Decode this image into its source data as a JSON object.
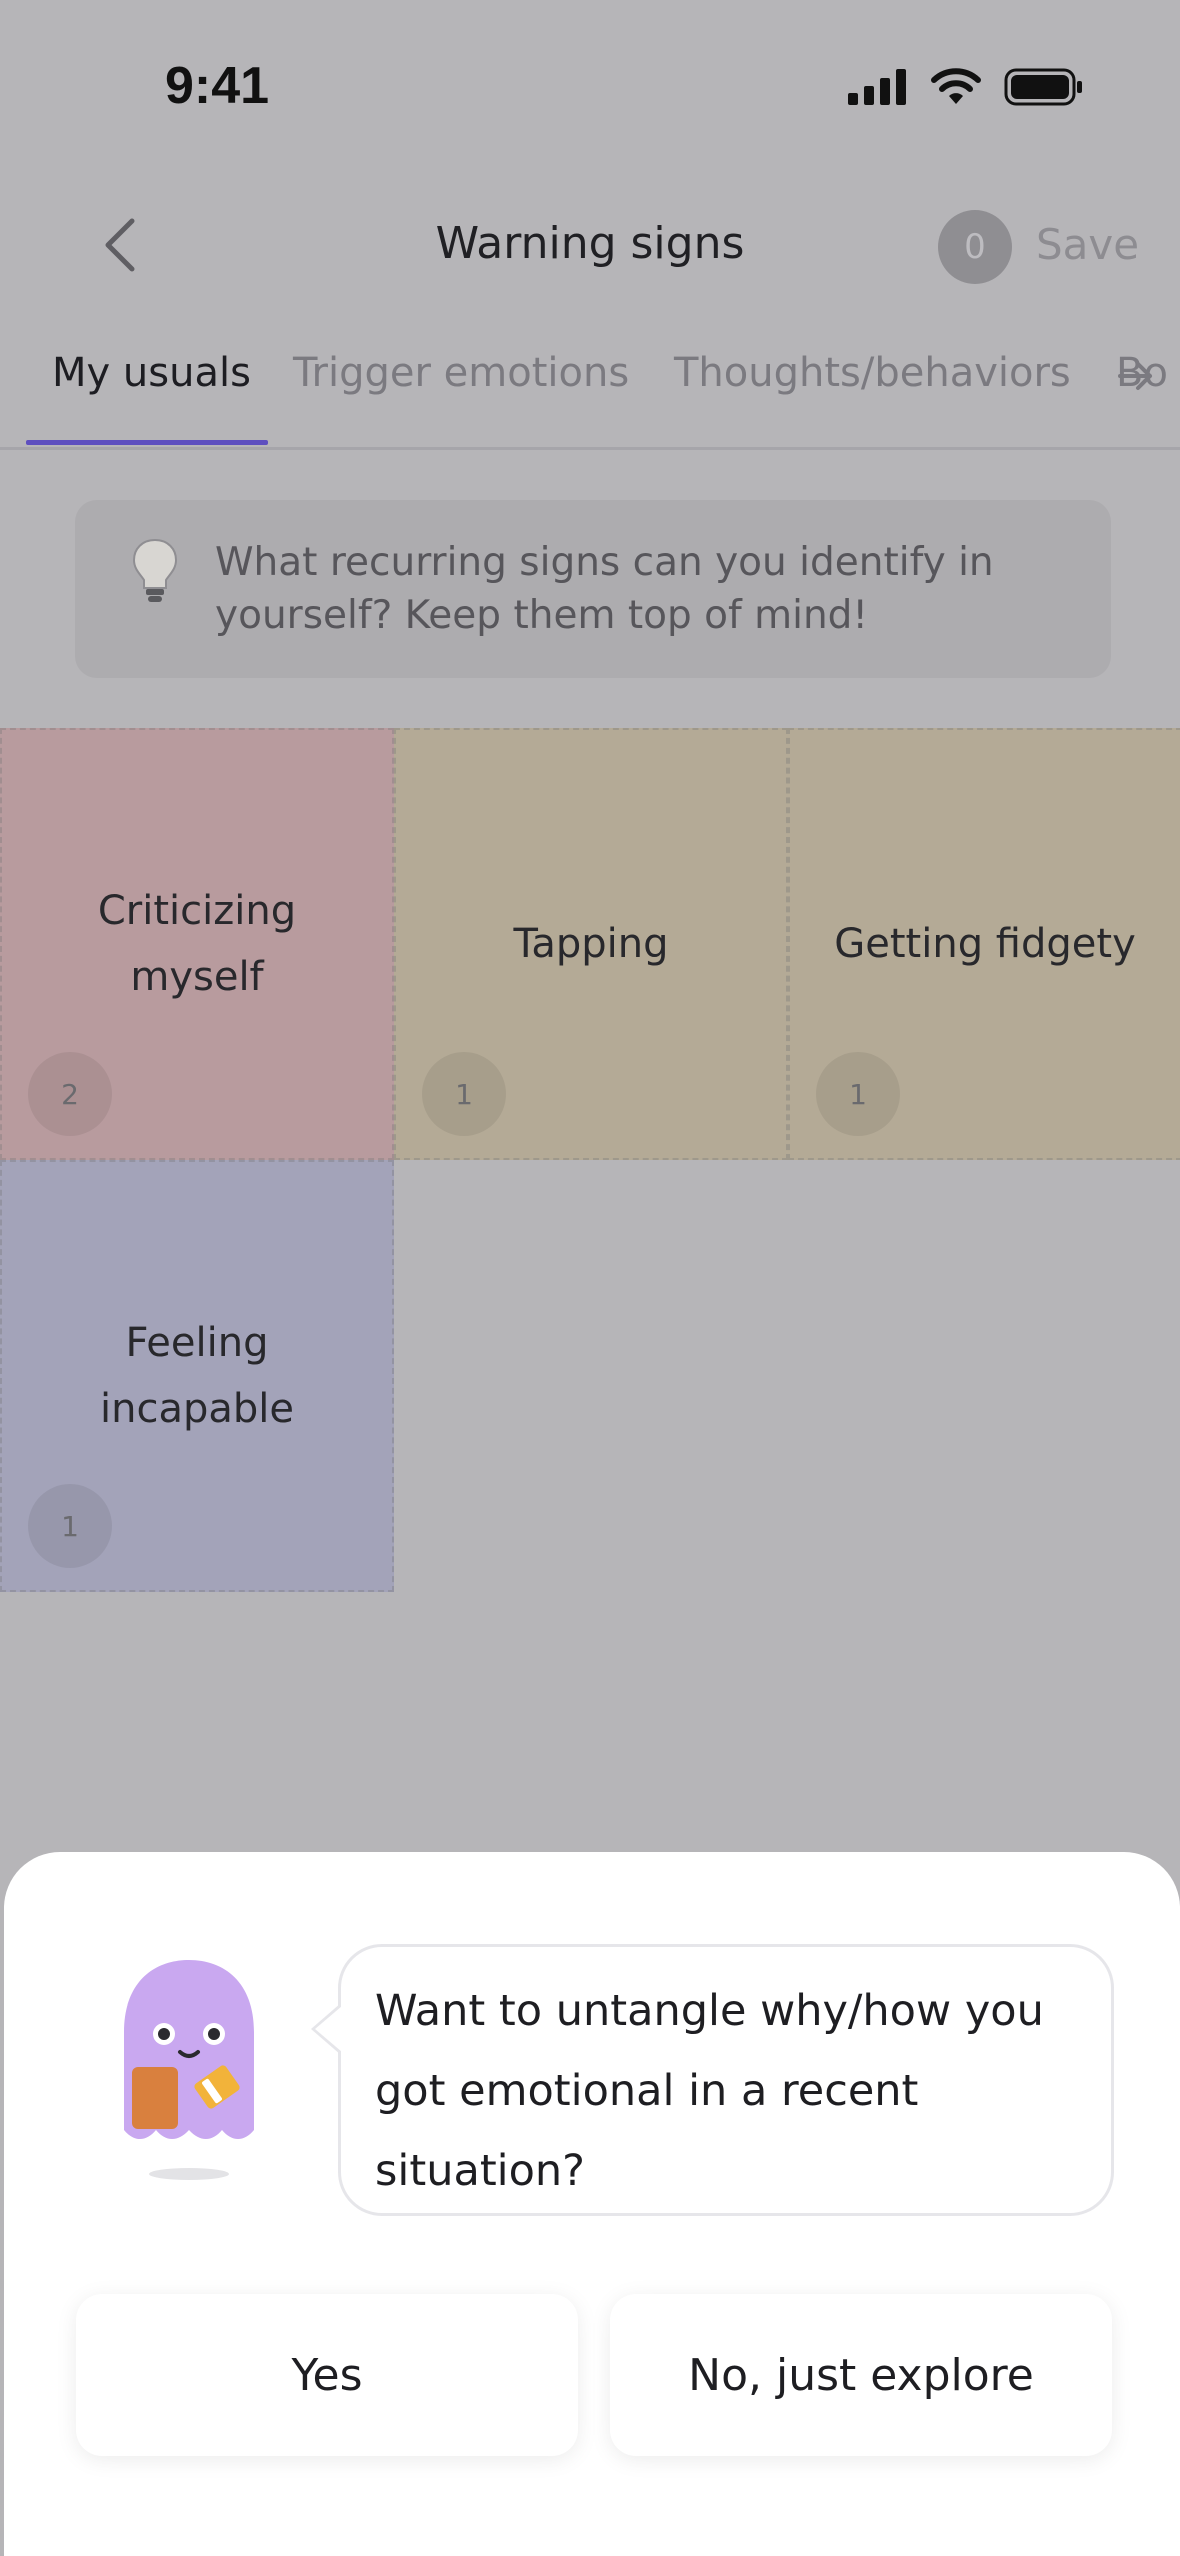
{
  "status_bar": {
    "time": "9:41"
  },
  "header": {
    "title": "Warning signs",
    "save_count": "0",
    "save_label": "Save"
  },
  "tabs": [
    {
      "label": "My usuals",
      "active": true
    },
    {
      "label": "Trigger emotions",
      "active": false
    },
    {
      "label": "Thoughts/behaviors",
      "active": false
    },
    {
      "label": "Bo",
      "active": false
    }
  ],
  "tip": {
    "icon": "lightbulb-icon",
    "text": "What recurring signs can you identify in yourself? Keep them top of mind!"
  },
  "tiles": [
    {
      "label": "Criticizing myself",
      "count": "2",
      "color": "#b89b9e"
    },
    {
      "label": "Tapping",
      "count": "1",
      "color": "#b4aa96"
    },
    {
      "label": "Getting fidgety",
      "count": "1",
      "color": "#b4aa96"
    },
    {
      "label": "Feeling incapable",
      "count": "1",
      "color": "#a3a3b9"
    }
  ],
  "sheet": {
    "prompt": "Want to untangle why/how you got emotional in a recent situation?",
    "yes_label": "Yes",
    "no_label": "No, just explore"
  },
  "colors": {
    "accent": "#5e4fbf",
    "overlay": "#b6b5b8",
    "mascot": "#c9a8f0"
  }
}
